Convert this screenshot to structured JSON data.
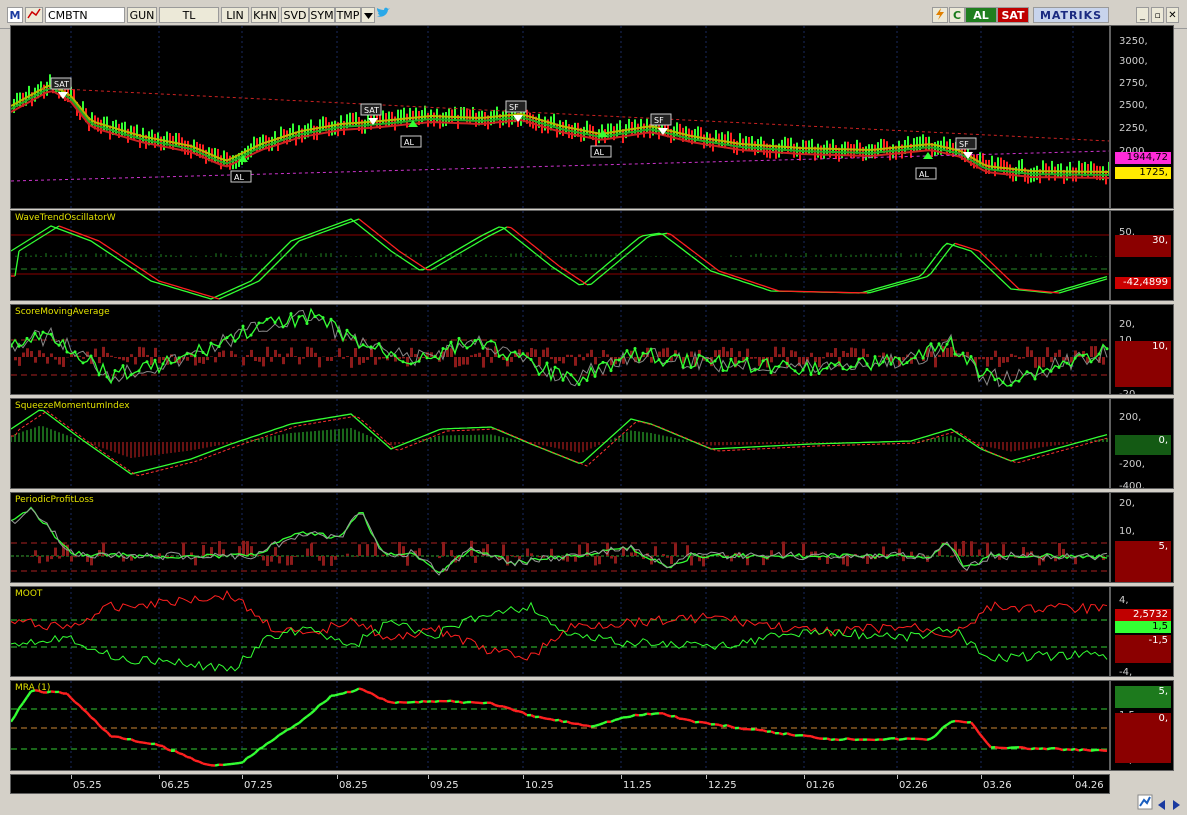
{
  "toolbar": {
    "app_logo": "M",
    "symbol": "CMBTN",
    "buttons": [
      "GUN",
      "TL",
      "LIN",
      "KHN",
      "SVD",
      "SYM",
      "TMP"
    ],
    "al_label": "AL",
    "sat_label": "SAT",
    "brand": "MATRIKS",
    "icons": [
      "lightning-icon",
      "refresh-c-icon",
      "dropdown-icon",
      "twitter-bird-icon",
      "minimize-icon",
      "restore-icon",
      "close-icon"
    ],
    "colors": {
      "al": "#1f7f1f",
      "sat": "#c00000",
      "brand_bg": "#c8d4ec"
    }
  },
  "panels": [
    {
      "name": "price",
      "label": "",
      "ticks": [
        "3250,",
        "3000,",
        "2750,",
        "2500,",
        "2250,",
        "2000,",
        "1750,"
      ],
      "badges": [
        {
          "text": "1944,72",
          "color": "#ff2bd9"
        },
        {
          "text": "1725,",
          "color": "#ffea00"
        }
      ],
      "signals": [
        {
          "text": "SAT",
          "kind": "sell"
        },
        {
          "text": "AL",
          "kind": "buy"
        },
        {
          "text": "SAT",
          "kind": "sell"
        },
        {
          "text": "AL",
          "kind": "buy"
        },
        {
          "text": "SF",
          "kind": "sell"
        },
        {
          "text": "AL",
          "kind": "buy"
        },
        {
          "text": "SF",
          "kind": "sell"
        },
        {
          "text": "AL",
          "kind": "buy"
        },
        {
          "text": "SF",
          "kind": "sell"
        }
      ]
    },
    {
      "name": "WaveTrendOscillatorW",
      "label": "WaveTrendOscillatorW",
      "ticks": [
        "50,",
        "30,"
      ],
      "badges": [
        {
          "text": "30,",
          "color": "#8b0000"
        },
        {
          "text": "-42,4899",
          "color": "#cc0000"
        }
      ]
    },
    {
      "name": "ScoreMovingAverage",
      "label": "ScoreMovingAverage",
      "ticks": [
        "20,",
        "10,",
        "0,",
        "-10,",
        "-20,"
      ],
      "badges": [
        {
          "text": "10,",
          "color": "#8b0000"
        }
      ]
    },
    {
      "name": "SqueezeMomentumIndex",
      "label": "SqueezeMomentumIndex",
      "ticks": [
        "200,",
        "0,",
        "-200,",
        "-400,"
      ],
      "badges": [
        {
          "text": "0,",
          "color": "#145a14"
        }
      ]
    },
    {
      "name": "PeriodicProfitLoss",
      "label": "PeriodicProfitLoss",
      "ticks": [
        "20,",
        "10,",
        "5,",
        "0,",
        "-5,"
      ],
      "badges": [
        {
          "text": "5,",
          "color": "#8b0000"
        }
      ]
    },
    {
      "name": "MOOT",
      "label": "MOOT",
      "ticks": [
        "4,",
        "1,5",
        "0,",
        "-1,5",
        "-4,"
      ],
      "badges": [
        {
          "text": "2,5732",
          "color": "#c00000"
        },
        {
          "text": "1,5",
          "color": "#33ff33"
        },
        {
          "text": "-1,5",
          "color": "#8b0000"
        }
      ]
    },
    {
      "name": "MRA",
      "label": "MRA (1)",
      "ticks": [
        "5,",
        "1,5",
        "0,",
        "-1,5",
        "-5,"
      ],
      "badges": [
        {
          "text": "5,",
          "color": "#1d7a1d"
        },
        {
          "text": "0,",
          "color": "#8b0000"
        }
      ]
    }
  ],
  "xaxis": {
    "labels": [
      "05.25",
      "06.25",
      "07.25",
      "08.25",
      "09.25",
      "10.25",
      "11.25",
      "12.25",
      "01.26",
      "02.26",
      "03.26",
      "04.26"
    ]
  },
  "status_icons": [
    "chart-settings-icon",
    "scroll-left-icon",
    "scroll-right-icon"
  ]
}
